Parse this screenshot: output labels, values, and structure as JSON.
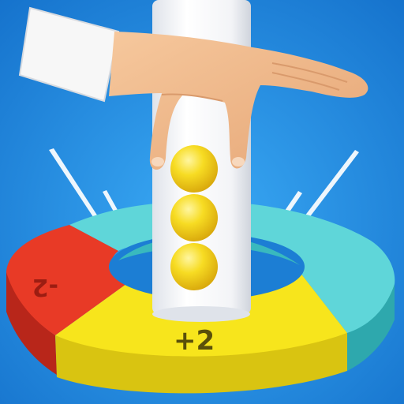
{
  "colors": {
    "background_top": "#1e7fd6",
    "background_bottom": "#2e9ef0",
    "pole": "#ffffff",
    "ring_red": "#e83a26",
    "ring_yellow": "#f7e51c",
    "ring_cyan": "#4fd0d4",
    "ball": "#f4d21a",
    "skin": "#f1bd8e",
    "sleeve": "#f7f7f7"
  },
  "ring": {
    "left_label": "-2",
    "front_label": "+2"
  },
  "balls": {
    "count": 3
  }
}
